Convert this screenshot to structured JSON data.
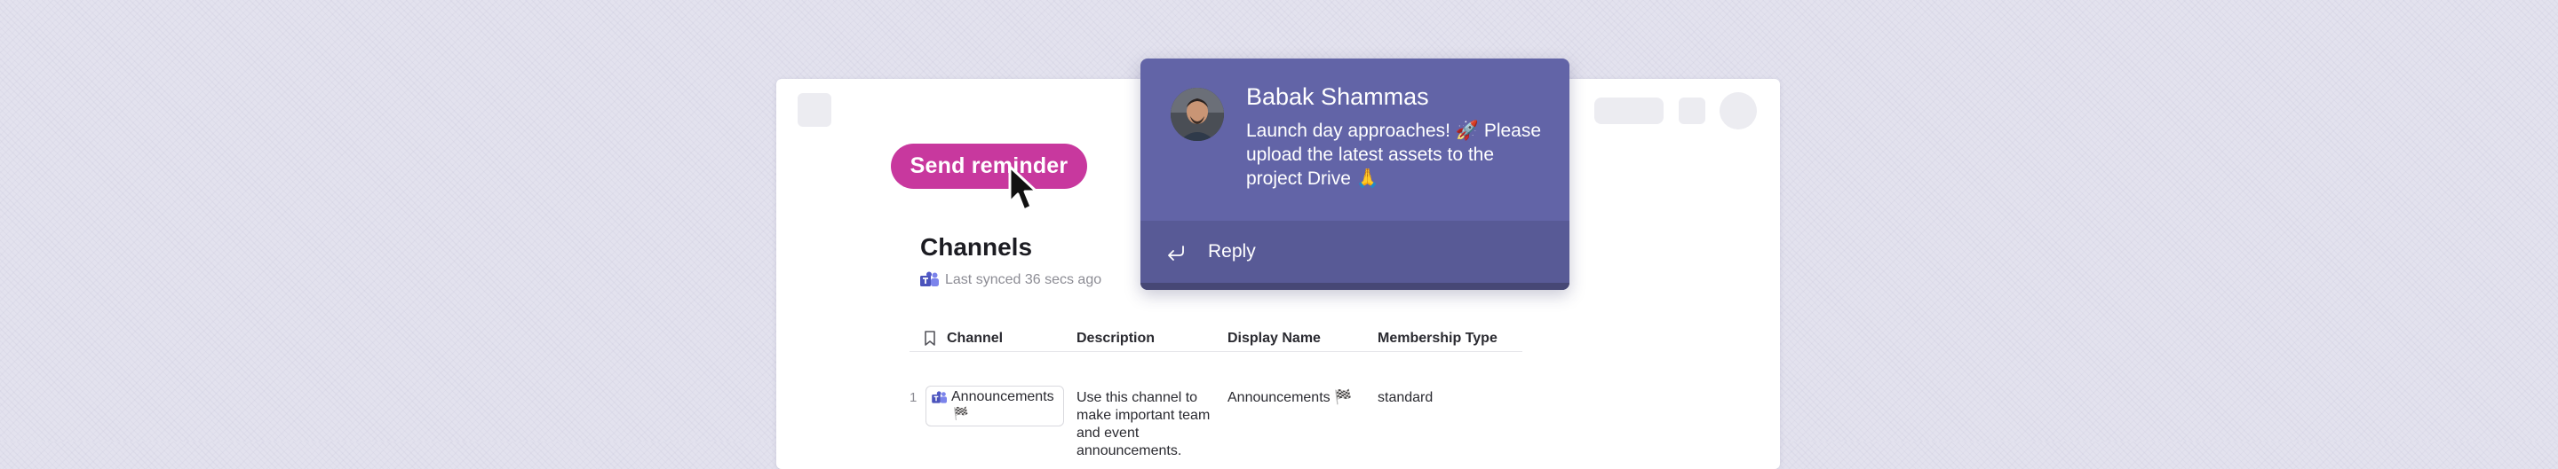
{
  "send_button": {
    "label": "Send reminder"
  },
  "channels": {
    "title": "Channels",
    "sync_status": "Last synced 36 secs ago"
  },
  "table": {
    "columns": [
      "Channel",
      "Description",
      "Display Name",
      "Membership Type"
    ],
    "rows": [
      {
        "index": "1",
        "channel": "Announcements",
        "channel_emoji": "🏁",
        "description": "Use this channel to make important team and event announcements.",
        "display_name": "Announcements 🏁",
        "membership_type": "standard"
      }
    ]
  },
  "notification": {
    "sender": "Babak Shammas",
    "message": "Launch day approaches! 🚀 Please upload the latest assets to the project Drive 🙏",
    "reply_label": "Reply"
  },
  "colors": {
    "accent_button": "#c8389e",
    "notification_bg": "#6264a7",
    "notification_reply_bg": "#585a96"
  },
  "icons": {
    "teams": "teams-icon",
    "bookmark": "bookmark-icon",
    "reply": "reply-arrow-icon",
    "cursor": "mouse-pointer-icon"
  }
}
